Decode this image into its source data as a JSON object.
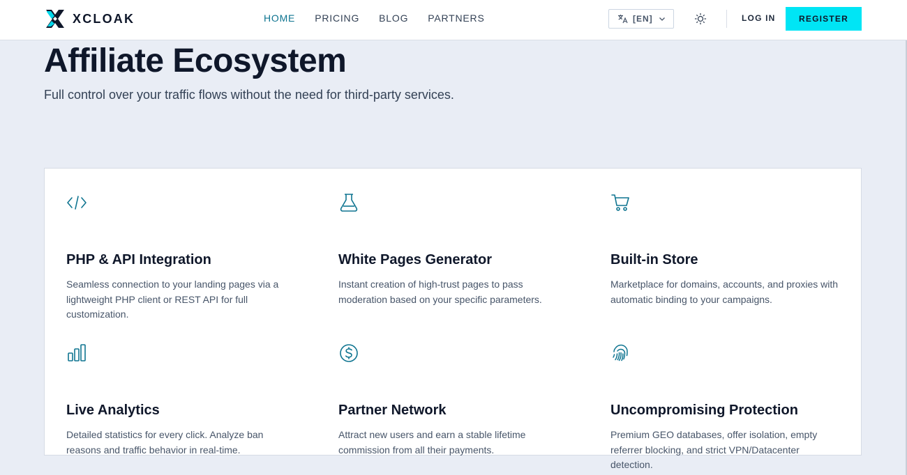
{
  "brand": {
    "name": "XCLOAK"
  },
  "nav": {
    "items": [
      {
        "label": "HOME",
        "active": true
      },
      {
        "label": "PRICING",
        "active": false
      },
      {
        "label": "BLOG",
        "active": false
      },
      {
        "label": "PARTNERS",
        "active": false
      }
    ]
  },
  "header": {
    "language": "[EN]",
    "login_label": "LOG IN",
    "register_label": "REGISTER",
    "language_icon": "translate-icon",
    "theme_icon": "sun-icon"
  },
  "hero": {
    "title": "Affiliate Ecosystem",
    "subtitle": "Full control over your traffic flows without the need for third-party services."
  },
  "features": [
    {
      "icon": "code-icon",
      "title": "PHP & API Integration",
      "description": "Seamless connection to your landing pages via a lightweight PHP client or REST API for full customization."
    },
    {
      "icon": "flask-icon",
      "title": "White Pages Generator",
      "description": "Instant creation of high-trust pages to pass moderation based on your specific parameters."
    },
    {
      "icon": "shopping-cart-icon",
      "title": "Built-in Store",
      "description": "Marketplace for domains, accounts, and proxies with automatic binding to your campaigns."
    },
    {
      "icon": "bar-chart-icon",
      "title": "Live Analytics",
      "description": "Detailed statistics for every click. Analyze ban reasons and traffic behavior in real-time."
    },
    {
      "icon": "dollar-circle-icon",
      "title": "Partner Network",
      "description": "Attract new users and earn a stable lifetime commission from all their payments."
    },
    {
      "icon": "fingerprint-icon",
      "title": "Uncompromising Protection",
      "description": "Premium GEO databases, offer isolation, empty referrer blocking, and strict VPN/Datacenter detection."
    }
  ],
  "colors": {
    "accent": "#0e7490",
    "register_button": "#00e5f5",
    "page_background": "#e9edf5"
  }
}
